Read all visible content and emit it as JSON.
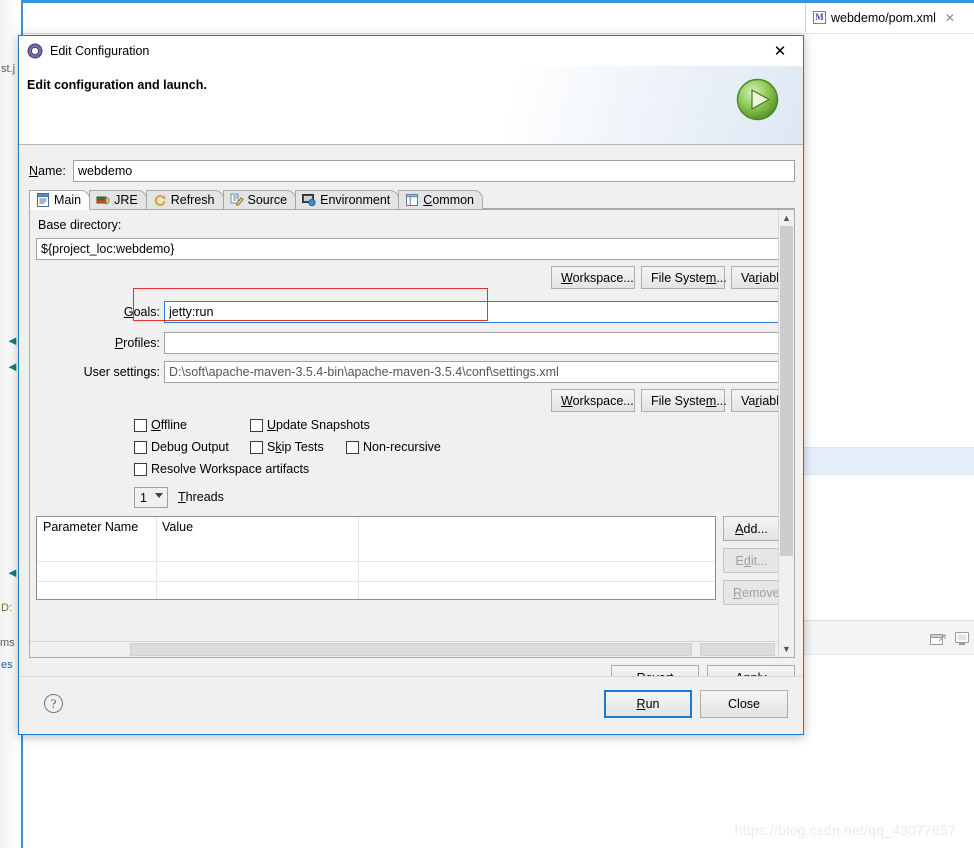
{
  "background": {
    "editor_tab": {
      "label": "webdemo/pom.xml",
      "icon": "xml-file-icon",
      "close": "✕"
    },
    "left_tab_labels": [
      "st.j",
      "D:",
      "ms",
      "es"
    ],
    "watermark": "https://blog.csdn.net/qq_43077857",
    "toolbar_icons": [
      "restore-view-icon",
      "monitor-icon"
    ],
    "accent_color": "#3a93d8"
  },
  "dialog": {
    "titlebar": {
      "title": "Edit Configuration",
      "icon": "configuration-icon",
      "close_label": "✕"
    },
    "header": {
      "title": "Edit configuration and launch.",
      "run_icon": "run-play-icon"
    },
    "name": {
      "label": "Name:",
      "mnemonic": "N",
      "value": "webdemo"
    },
    "tabs": [
      {
        "label": "Main",
        "icon": "main-tab-icon",
        "active": true
      },
      {
        "label": "JRE",
        "icon": "jre-tab-icon",
        "active": false
      },
      {
        "label": "Refresh",
        "icon": "refresh-tab-icon",
        "active": false
      },
      {
        "label": "Source",
        "icon": "source-tab-icon",
        "active": false
      },
      {
        "label": "Environment",
        "icon": "environment-tab-icon",
        "active": false
      },
      {
        "label": "Common",
        "icon": "common-tab-icon",
        "active": false
      }
    ],
    "main_tab": {
      "base_directory_label": "Base directory:",
      "base_directory_value": "${project_loc:webdemo}",
      "dir_buttons": [
        {
          "label": "Workspace...",
          "enabled": true
        },
        {
          "label": "File System...",
          "enabled": true
        },
        {
          "label": "Variables...",
          "enabled": true
        }
      ],
      "goals_label": "Goals:",
      "goals_value": "jetty:run",
      "profiles_label": "Profiles:",
      "profiles_value": "",
      "user_settings_label": "User settings:",
      "user_settings_value": "D:\\soft\\apache-maven-3.5.4-bin\\apache-maven-3.5.4\\conf\\settings.xml",
      "settings_buttons": [
        {
          "label": "Workspace...",
          "enabled": true
        },
        {
          "label": "File System...",
          "enabled": true
        },
        {
          "label": "Variables...",
          "enabled": true
        }
      ],
      "checkboxes": [
        {
          "label": "Offline",
          "checked": false
        },
        {
          "label": "Update Snapshots",
          "checked": false
        },
        {
          "label": "Debug Output",
          "checked": false
        },
        {
          "label": "Skip Tests",
          "checked": false
        },
        {
          "label": "Non-recursive",
          "checked": false
        },
        {
          "label": "Resolve Workspace artifacts",
          "checked": false
        }
      ],
      "threads": {
        "value": "1",
        "label": "Threads"
      },
      "parameter_table": {
        "columns": [
          "Parameter Name",
          "Value",
          ""
        ],
        "rows": []
      },
      "table_buttons": [
        {
          "label": "Add...",
          "enabled": true
        },
        {
          "label": "Edit...",
          "enabled": false
        },
        {
          "label": "Remove",
          "enabled": false
        }
      ]
    },
    "mid_buttons": [
      {
        "label": "Revert",
        "enabled": true
      },
      {
        "label": "Apply",
        "enabled": true
      }
    ],
    "footer": {
      "help_glyph": "?",
      "buttons": [
        {
          "label": "Run",
          "default": true
        },
        {
          "label": "Close",
          "default": false
        }
      ]
    }
  }
}
